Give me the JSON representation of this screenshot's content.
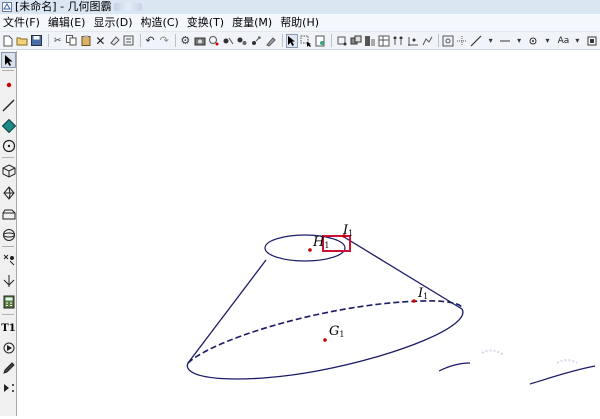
{
  "window": {
    "title": "[未命名] - 几何图霸"
  },
  "menu": [
    {
      "label": "文件(F)"
    },
    {
      "label": "编辑(E)"
    },
    {
      "label": "显示(D)"
    },
    {
      "label": "构造(C)"
    },
    {
      "label": "变换(T)"
    },
    {
      "label": "度量(M)"
    },
    {
      "label": "帮助(H)"
    }
  ],
  "toolbar": {
    "text_style": "Aa"
  },
  "left_tools": [
    {
      "name": "select-arrow-icon"
    },
    {
      "name": "point-icon"
    },
    {
      "name": "segment-icon"
    },
    {
      "name": "polygon-icon"
    },
    {
      "name": "circle-icon"
    },
    {
      "name": "cube-icon"
    },
    {
      "name": "octahedron-icon"
    },
    {
      "name": "prism-icon"
    },
    {
      "name": "sphere-icon"
    },
    {
      "name": "transform-icon"
    },
    {
      "name": "custom-tool-icon"
    },
    {
      "name": "calculator-icon"
    },
    {
      "name": "text-tool-icon"
    },
    {
      "name": "animation-icon"
    },
    {
      "name": "pen-icon"
    },
    {
      "name": "more-tools-icon"
    }
  ],
  "left_text": {
    "text_tool": "T1"
  },
  "points": [
    {
      "main": "H",
      "sub": "1"
    },
    {
      "main": "I",
      "sub": "1"
    },
    {
      "main": "I",
      "sub": "1"
    },
    {
      "main": "G",
      "sub": "1"
    }
  ],
  "colors": {
    "curve": "#1a1a66",
    "point": "#cc0000",
    "highlight": "#cc1133"
  }
}
